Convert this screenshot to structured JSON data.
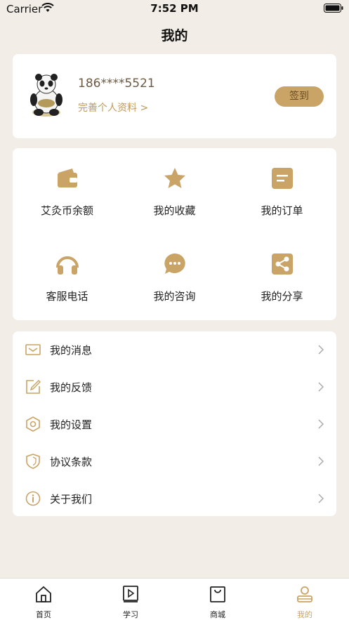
{
  "status_bar": {
    "carrier": "Carrier",
    "time": "7:52 PM"
  },
  "page": {
    "title": "我的"
  },
  "profile": {
    "phone": "186****5521",
    "complete_link": "完善个人资料 >",
    "signin_label": "签到"
  },
  "grid": [
    {
      "label": "艾灸币余额",
      "icon": "wallet-icon"
    },
    {
      "label": "我的收藏",
      "icon": "star-icon"
    },
    {
      "label": "我的订单",
      "icon": "order-icon"
    },
    {
      "label": "客服电话",
      "icon": "headphones-icon"
    },
    {
      "label": "我的咨询",
      "icon": "chat-icon"
    },
    {
      "label": "我的分享",
      "icon": "share-icon"
    }
  ],
  "menu": [
    {
      "label": "我的消息",
      "icon": "mail-icon"
    },
    {
      "label": "我的反馈",
      "icon": "edit-icon"
    },
    {
      "label": "我的设置",
      "icon": "settings-icon"
    },
    {
      "label": "协议条款",
      "icon": "shield-icon"
    },
    {
      "label": "关于我们",
      "icon": "info-icon"
    }
  ],
  "tabs": [
    {
      "label": "首页",
      "icon": "home-icon"
    },
    {
      "label": "学习",
      "icon": "video-icon"
    },
    {
      "label": "商城",
      "icon": "shopping-bag-icon"
    },
    {
      "label": "我的",
      "icon": "user-icon",
      "active": true
    }
  ],
  "colors": {
    "accent": "#c9a466",
    "background": "#f2ede6",
    "card": "#ffffff"
  }
}
